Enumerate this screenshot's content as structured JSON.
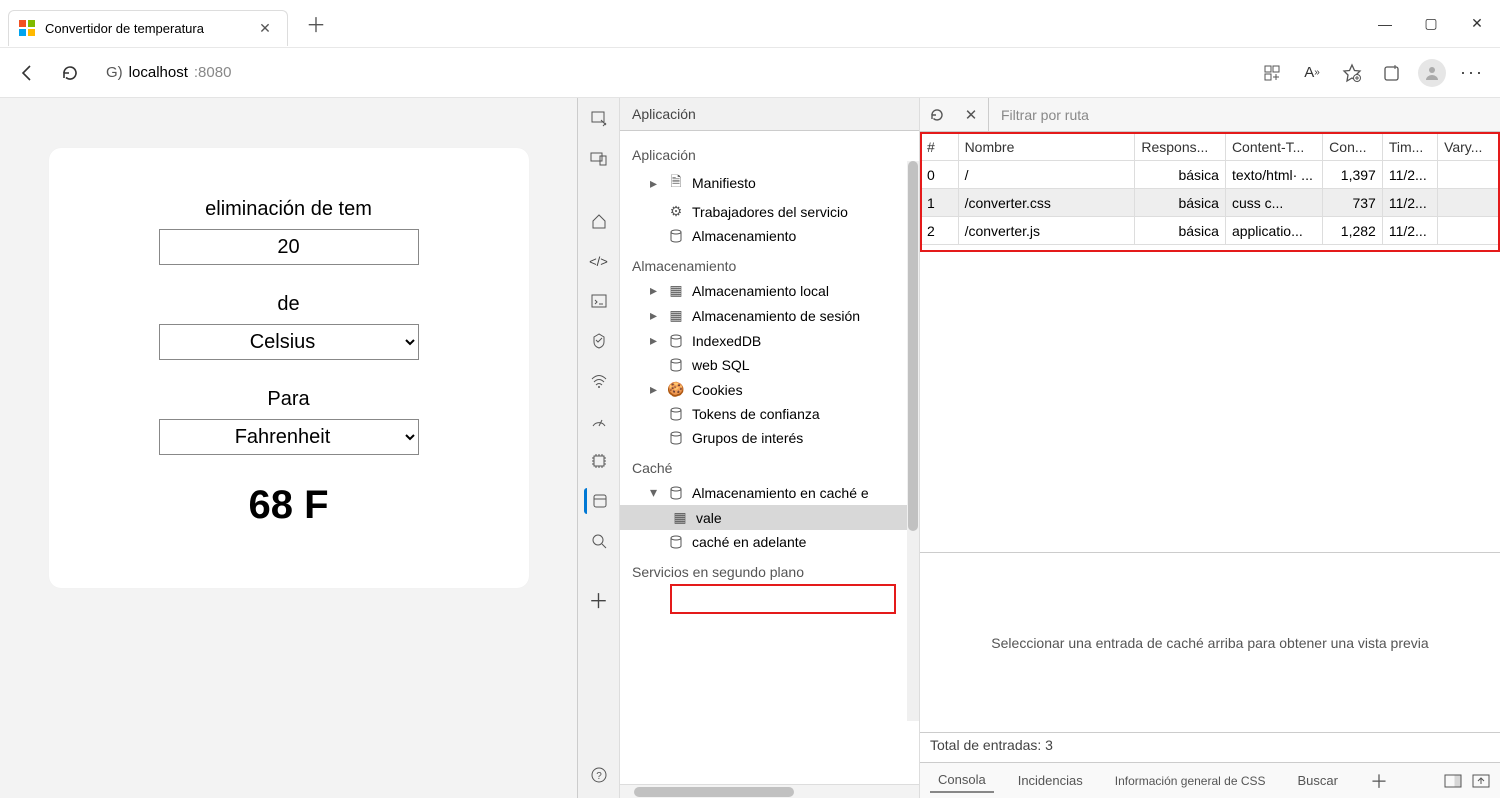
{
  "browser": {
    "tab_title": "Convertidor de temperatura",
    "url_prefix": "G)",
    "url_host": "localhost",
    "url_port": ":8080"
  },
  "page": {
    "label_temp": "eliminación de tem",
    "value_temp": "20",
    "label_from": "de",
    "value_from": "Celsius",
    "label_to": "Para",
    "value_to": "Fahrenheit",
    "result": "68 F"
  },
  "devtools": {
    "panel_title": "Aplicación",
    "sections": {
      "app": "Aplicación",
      "storage": "Almacenamiento",
      "cache": "Caché",
      "bg": "Servicios en segundo plano"
    },
    "tree": {
      "manifest": "Manifiesto",
      "sw": "Trabajadores del servicio",
      "storage_item": "Almacenamiento",
      "local": "Almacenamiento local",
      "session": "Almacenamiento de sesión",
      "idb": "IndexedDB",
      "websql": "web SQL",
      "cookies": "Cookies",
      "trust": "Tokens de confianza",
      "interest": "Grupos de interés",
      "cache_storage": "Almacenamiento en caché e",
      "cache_entry": "vale",
      "cache_fwd": "caché en adelante"
    },
    "filter_placeholder": "Filtrar por ruta",
    "table": {
      "headers": {
        "idx": "#",
        "name": "Nombre",
        "resp": "Respons...",
        "ct": "Content-T...",
        "len": "Con...",
        "time": "Tim...",
        "vary": "Vary..."
      },
      "rows": [
        {
          "idx": "0",
          "name": "/",
          "resp": "básica",
          "ct": "texto/html· ...",
          "len": "1,397",
          "time": "11/2...",
          "vary": ""
        },
        {
          "idx": "1",
          "name": "/converter.css",
          "resp": "básica",
          "ct": "cuss c...",
          "len": "737",
          "time": "11/2...",
          "vary": ""
        },
        {
          "idx": "2",
          "name": "/converter.js",
          "resp": "básica",
          "ct": "applicatio...",
          "len": "1,282",
          "time": "11/2...",
          "vary": ""
        }
      ]
    },
    "preview_empty": "Seleccionar una entrada de caché arriba para obtener una vista previa",
    "status_text": "Total de entradas: 3",
    "drawer": {
      "console": "Consola",
      "issues": "Incidencias",
      "css": "Información general de CSS",
      "search": "Buscar"
    }
  }
}
